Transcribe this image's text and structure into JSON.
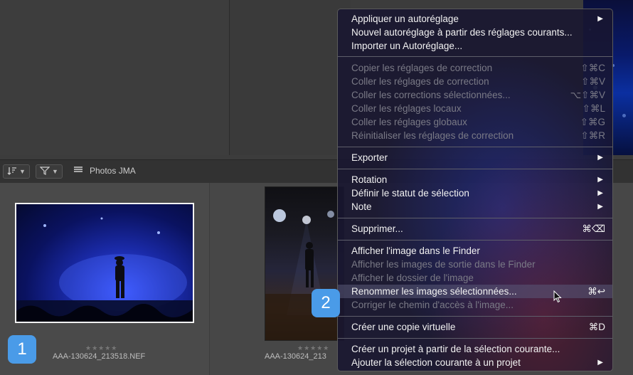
{
  "toolbar": {
    "sort_icon": "sort-icon",
    "filter_icon": "filter-icon",
    "library_icon": "library-grid-icon",
    "library_name": "Photos JMA"
  },
  "browser": {
    "items": [
      {
        "rating": "★★★★★",
        "filename": "AAA-130624_213518.NEF"
      },
      {
        "rating": "★★★★★",
        "filename": "AAA-130624_213"
      }
    ]
  },
  "badges": {
    "one": "1",
    "two": "2"
  },
  "menu": {
    "items": [
      {
        "label": "Appliquer un autoréglage",
        "shortcut": "",
        "submenu": true,
        "enabled": true
      },
      {
        "label": "Nouvel autoréglage à partir des réglages courants...",
        "shortcut": "",
        "submenu": false,
        "enabled": true
      },
      {
        "label": "Importer un Autoréglage...",
        "shortcut": "",
        "submenu": false,
        "enabled": true
      },
      {
        "label": "Copier les réglages de correction",
        "shortcut": "⇧⌘C",
        "submenu": false,
        "enabled": false
      },
      {
        "label": "Coller les réglages de correction",
        "shortcut": "⇧⌘V",
        "submenu": false,
        "enabled": false
      },
      {
        "label": "Coller les corrections sélectionnées...",
        "shortcut": "⌥⇧⌘V",
        "submenu": false,
        "enabled": false
      },
      {
        "label": "Coller les réglages locaux",
        "shortcut": "⇧⌘L",
        "submenu": false,
        "enabled": false
      },
      {
        "label": "Coller les réglages globaux",
        "shortcut": "⇧⌘G",
        "submenu": false,
        "enabled": false
      },
      {
        "label": "Réinitialiser les réglages de correction",
        "shortcut": "⇧⌘R",
        "submenu": false,
        "enabled": false
      },
      {
        "label": "Exporter",
        "shortcut": "",
        "submenu": true,
        "enabled": true
      },
      {
        "label": "Rotation",
        "shortcut": "",
        "submenu": true,
        "enabled": true
      },
      {
        "label": "Définir le statut de sélection",
        "shortcut": "",
        "submenu": true,
        "enabled": true
      },
      {
        "label": "Note",
        "shortcut": "",
        "submenu": true,
        "enabled": true
      },
      {
        "label": "Supprimer...",
        "shortcut": "⌘⌫",
        "submenu": false,
        "enabled": true
      },
      {
        "label": "Afficher l'image dans le Finder",
        "shortcut": "",
        "submenu": false,
        "enabled": true
      },
      {
        "label": "Afficher les images de sortie dans le Finder",
        "shortcut": "",
        "submenu": false,
        "enabled": false
      },
      {
        "label": "Afficher le dossier de l'image",
        "shortcut": "",
        "submenu": false,
        "enabled": false
      },
      {
        "label": "Renommer les images sélectionnées...",
        "shortcut": "⌘↩",
        "submenu": false,
        "enabled": true,
        "highlighted": true
      },
      {
        "label": "Corriger le chemin d'accès à l'image...",
        "shortcut": "",
        "submenu": false,
        "enabled": false
      },
      {
        "label": "Créer une copie virtuelle",
        "shortcut": "⌘D",
        "submenu": false,
        "enabled": true
      },
      {
        "label": "Créer un projet à partir de la sélection courante...",
        "shortcut": "",
        "submenu": false,
        "enabled": true
      },
      {
        "label": "Ajouter la sélection courante à un projet",
        "shortcut": "",
        "submenu": true,
        "enabled": true
      }
    ],
    "submenu_arrow": "▶"
  }
}
